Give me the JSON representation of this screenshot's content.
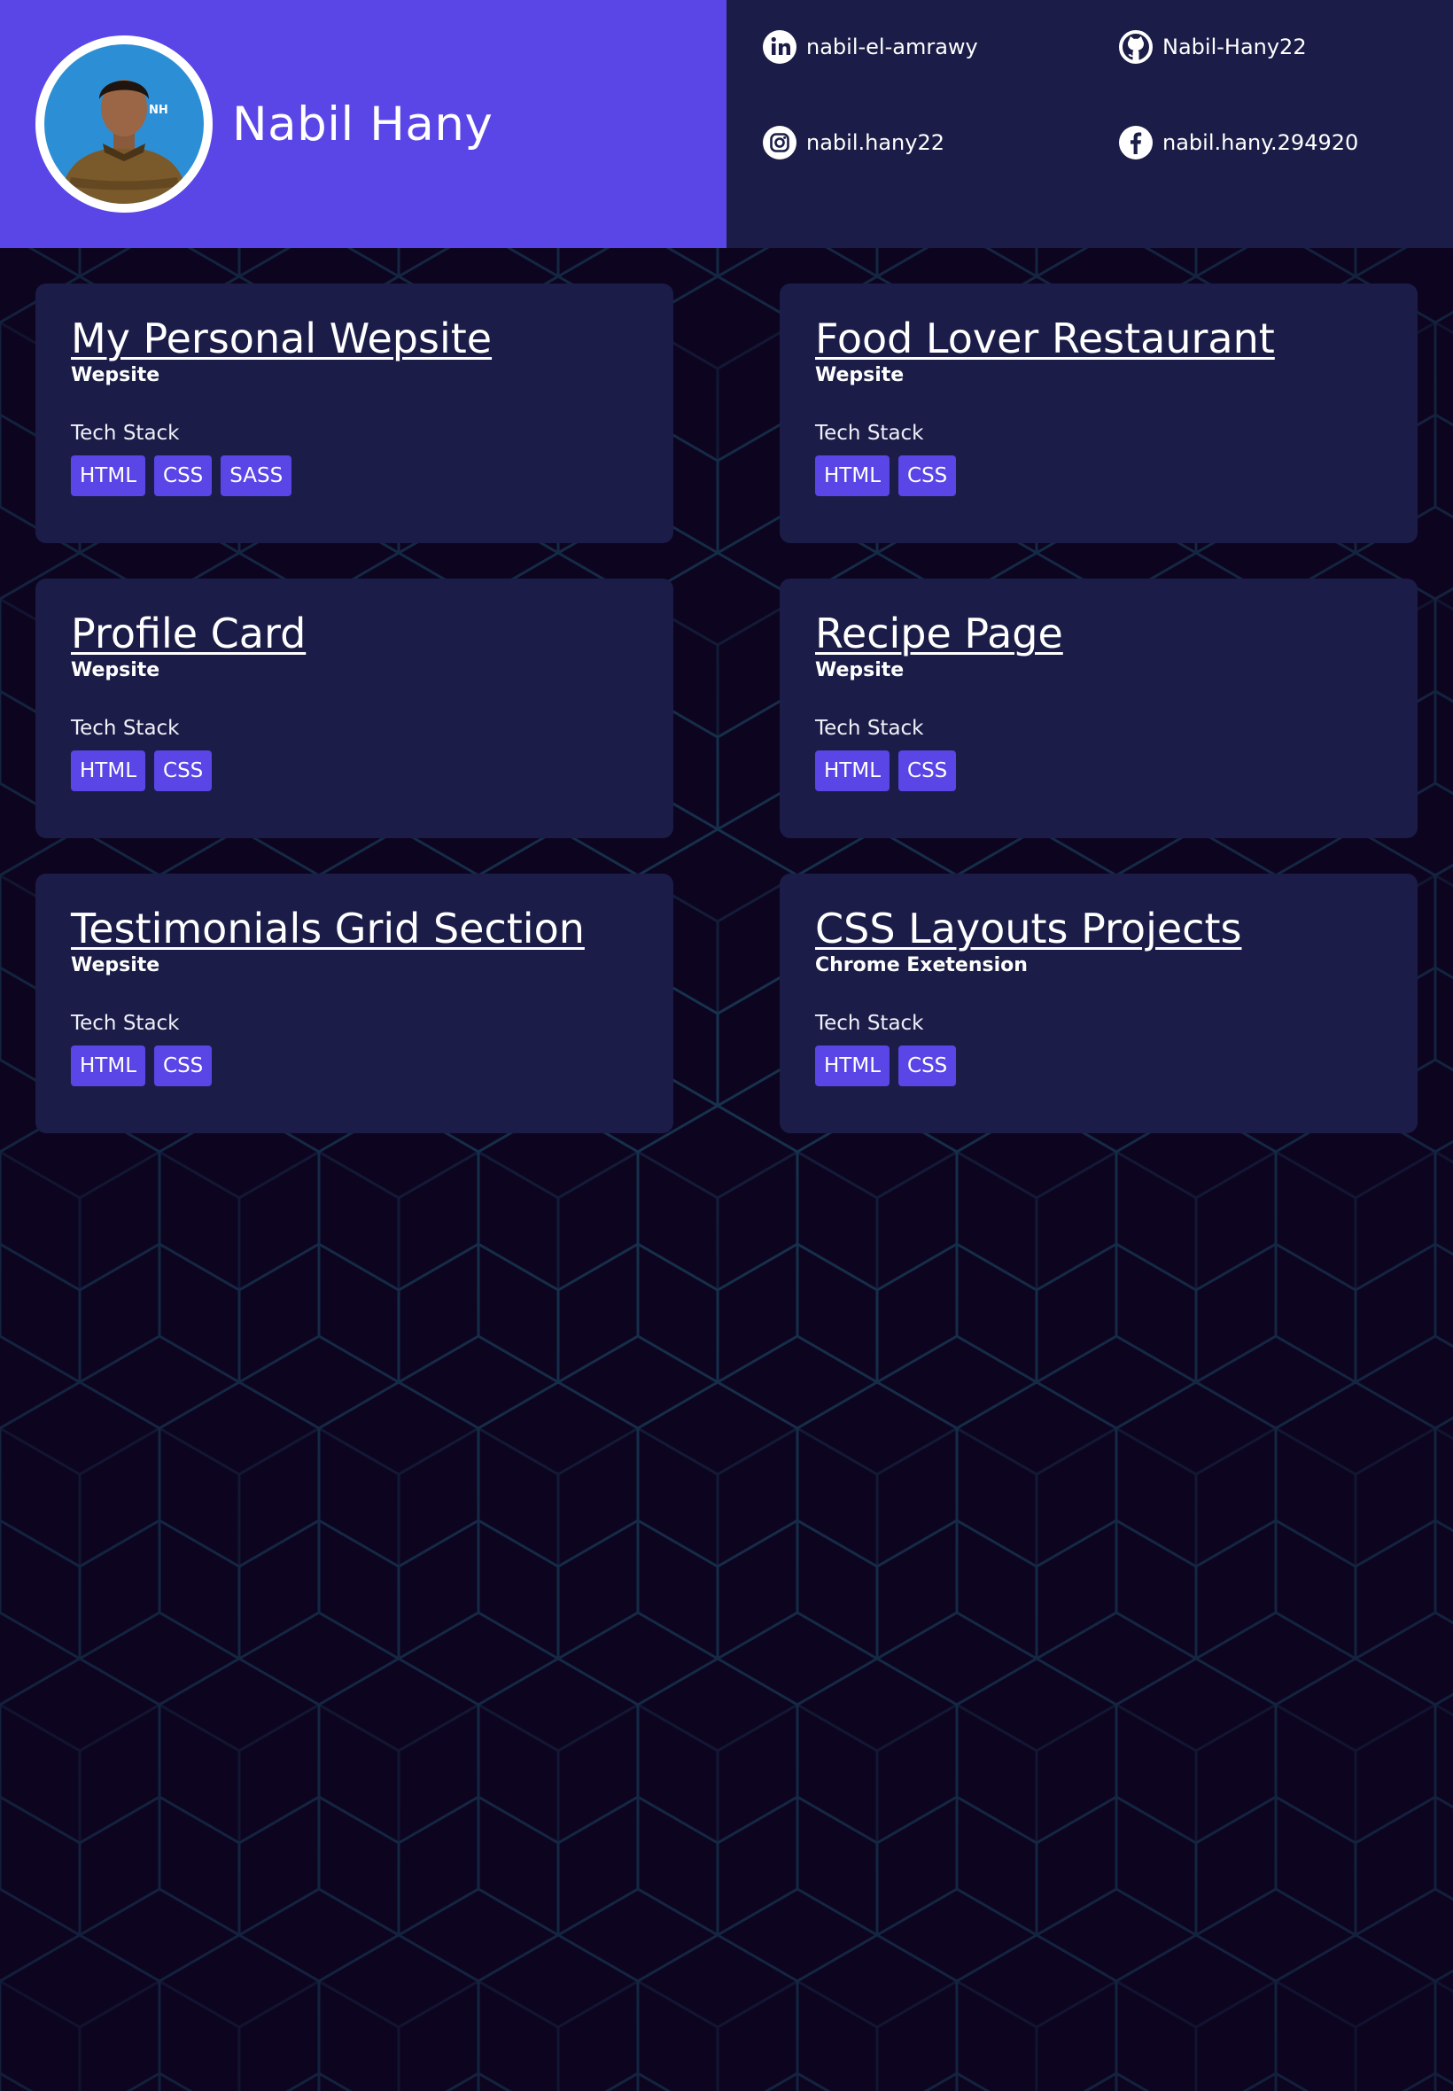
{
  "profile": {
    "name": "Nabil Hany",
    "avatar_alt": "Profile photo of Nabil Hany",
    "avatar_mark": "NH"
  },
  "social": [
    {
      "icon": "linkedin-icon",
      "label": "nabil-el-amrawy"
    },
    {
      "icon": "github-icon",
      "label": "Nabil-Hany22"
    },
    {
      "icon": "instagram-icon",
      "label": "nabil.hany22"
    },
    {
      "icon": "facebook-icon",
      "label": "nabil.hany.294920"
    }
  ],
  "projects": [
    {
      "title": "My Personal Wepsite",
      "type": "Wepsite",
      "stack_label": "Tech Stack",
      "tags": [
        "HTML",
        "CSS",
        "SASS"
      ]
    },
    {
      "title": "Food Lover Restaurant",
      "type": "Wepsite",
      "stack_label": "Tech Stack",
      "tags": [
        "HTML",
        "CSS"
      ]
    },
    {
      "title": "Profile Card",
      "type": "Wepsite",
      "stack_label": "Tech Stack",
      "tags": [
        "HTML",
        "CSS"
      ]
    },
    {
      "title": "Recipe Page",
      "type": "Wepsite",
      "stack_label": "Tech Stack",
      "tags": [
        "HTML",
        "CSS"
      ]
    },
    {
      "title": "Testimonials Grid Section",
      "type": "Wepsite",
      "stack_label": "Tech Stack",
      "tags": [
        "HTML",
        "CSS"
      ]
    },
    {
      "title": "CSS Layouts Projects",
      "type": "Chrome Exetension",
      "stack_label": "Tech Stack",
      "tags": [
        "HTML",
        "CSS"
      ]
    }
  ],
  "colors": {
    "accent": "#5a45e6",
    "panel": "#1b1d48",
    "background": "#0d0420",
    "pattern_line": "#173a55"
  }
}
